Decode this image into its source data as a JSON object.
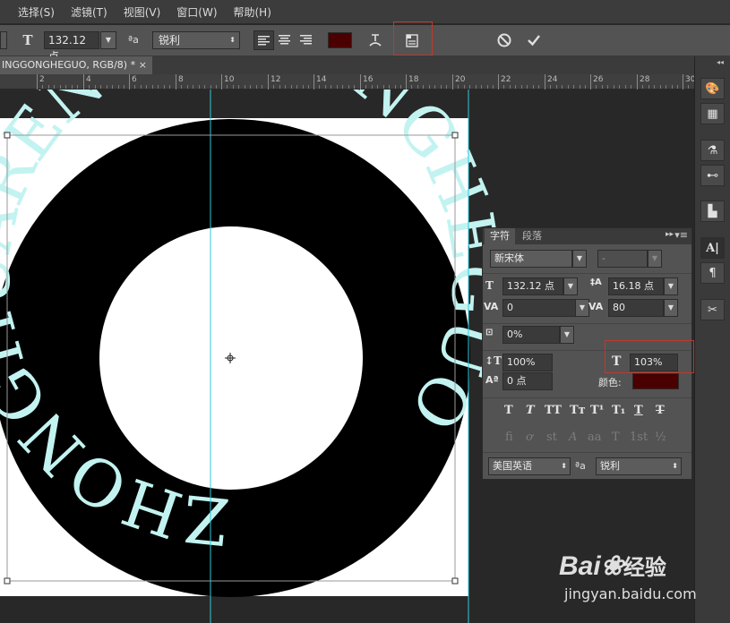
{
  "menu": [
    "选择(S)",
    "滤镜(T)",
    "视图(V)",
    "窗口(W)",
    "帮助(H)"
  ],
  "options": {
    "font_size": "132.12 点",
    "aa_label": "ªa",
    "antialias": "锐利",
    "color": "#4a0000"
  },
  "document": {
    "tab_title": "INGGONGHEGUO, RGB/8) *",
    "close": "×",
    "ring_text": "ZHONGHUARENMINGONGHEGUO",
    "ring_color": "#c2f3f1"
  },
  "ruler": [
    "2",
    "4",
    "6",
    "8",
    "10",
    "12",
    "14",
    "16",
    "18",
    "20",
    "22",
    "24",
    "26",
    "28",
    "30",
    "3"
  ],
  "character_panel": {
    "tabs": [
      "字符",
      "段落"
    ],
    "font_family": "新宋体",
    "font_style": "-",
    "size": "132.12 点",
    "leading": "16.18 点",
    "kerning": "0",
    "tracking": "80",
    "tsume": "0%",
    "vertical_scale": "100%",
    "horizontal_scale": "103%",
    "baseline_shift": "0 点",
    "color_label": "颜色:",
    "color": "#4a0000",
    "language": "美国英语",
    "aa_label": "ªa",
    "antialias": "锐利",
    "style_buttons": [
      "T",
      "T",
      "TT",
      "Tт",
      "T¹",
      "T₁",
      "T",
      "T"
    ],
    "opentype_buttons": [
      "fi",
      "ơ",
      "st",
      "A",
      "aa",
      "T",
      "1st",
      "½"
    ]
  },
  "watermark": {
    "brand": "Bai",
    "brand_suffix": "经验",
    "url": "jingyan.baidu.com"
  }
}
